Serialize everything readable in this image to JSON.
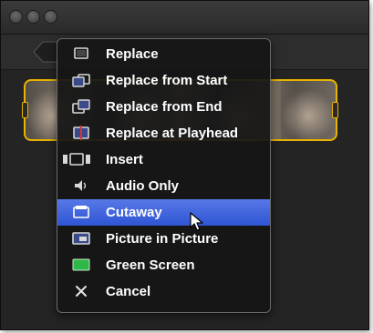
{
  "window": {
    "title_buttons": [
      "close",
      "minimize",
      "zoom"
    ]
  },
  "toolbar": {
    "back_icon": "chevron-left-icon"
  },
  "clip": {
    "selected": true,
    "highlight_color": "#e8b400"
  },
  "menu": {
    "items": [
      {
        "label": "Replace",
        "icon": "replace-icon",
        "selected": false
      },
      {
        "label": "Replace from Start",
        "icon": "replace-from-start-icon",
        "selected": false
      },
      {
        "label": "Replace from End",
        "icon": "replace-from-end-icon",
        "selected": false
      },
      {
        "label": "Replace at Playhead",
        "icon": "replace-at-playhead-icon",
        "selected": false
      },
      {
        "label": "Insert",
        "icon": "insert-icon",
        "selected": false
      },
      {
        "label": "Audio Only",
        "icon": "speaker-icon",
        "selected": false
      },
      {
        "label": "Cutaway",
        "icon": "cutaway-icon",
        "selected": true
      },
      {
        "label": "Picture in Picture",
        "icon": "picture-in-picture-icon",
        "selected": false
      },
      {
        "label": "Green Screen",
        "icon": "green-screen-icon",
        "selected": false
      },
      {
        "label": "Cancel",
        "icon": "close-icon",
        "selected": false
      }
    ],
    "selection_color": "#3a5fd8",
    "green_screen_color": "#2fb84a"
  }
}
